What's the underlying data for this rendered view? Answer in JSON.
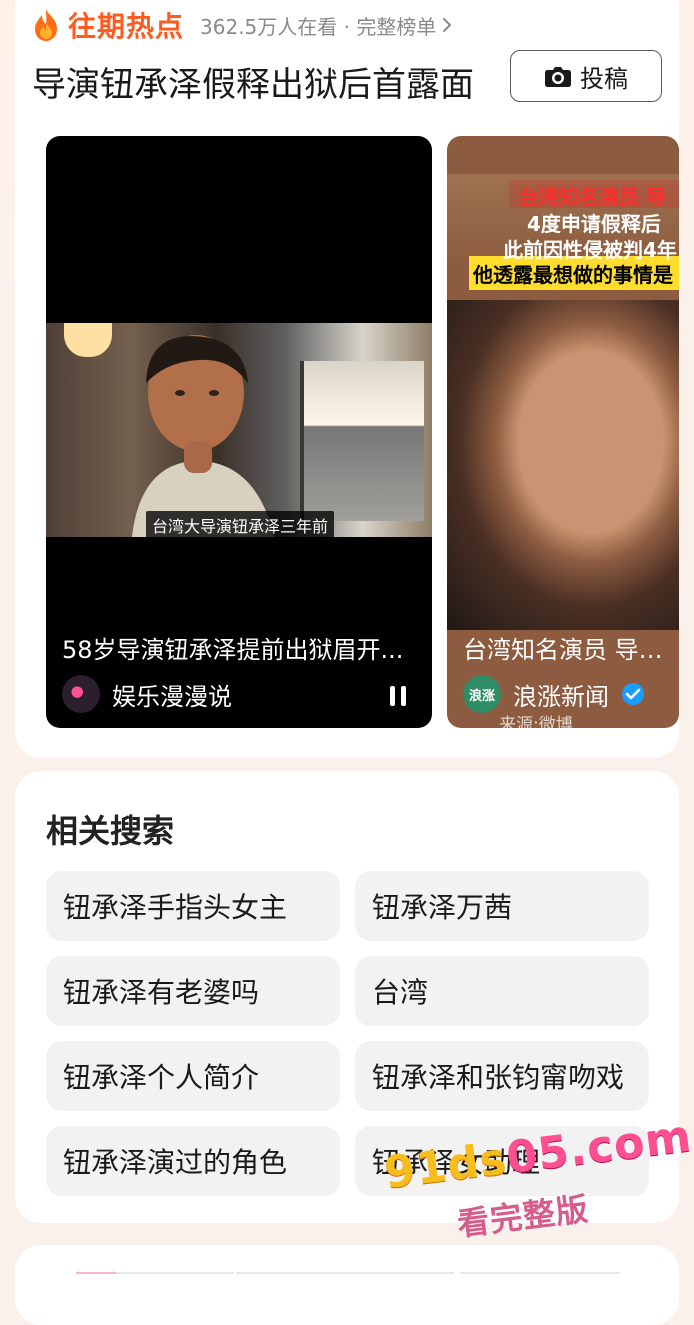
{
  "hot": {
    "title": "往期热点",
    "meta": "362.5万人在看 · 完整榜单",
    "headline": "导演钮承泽假释出狱后首露面",
    "post_label": "投稿"
  },
  "videos": [
    {
      "overlay_caption": "台湾大导演钮承泽三年前",
      "title": "58岁导演钮承泽提前出狱眉开...",
      "author": "娱乐漫漫说"
    },
    {
      "banner_lines": [
        "台湾知名演员 导",
        "4度申请假释后",
        "此前因性侵被判4年",
        "他透露最想做的事情是"
      ],
      "title": "台湾知名演员 导演钮",
      "author": "浪涨新闻",
      "avatar_text": "浪涨",
      "source_text": "来源:微博"
    }
  ],
  "related": {
    "title": "相关搜索",
    "items": [
      "钮承泽手指头女主",
      "钮承泽万茜",
      "钮承泽有老婆吗",
      "台湾",
      "钮承泽个人简介",
      "钮承泽和张钧甯吻戏",
      "钮承泽演过的角色",
      "钮承泽女助理"
    ]
  },
  "watermark": {
    "main_prefix": "91ds",
    "main_suffix": "05.com",
    "sub": "看完整版"
  },
  "colors": {
    "accent": "#ff5b1f",
    "background": "#fbf1ec",
    "chip_background": "#f2f2f2",
    "verified_blue": "#1b9cff"
  },
  "icons": {
    "flame": "flame-icon",
    "chevron": "chevron-right-icon",
    "camera": "camera-icon",
    "pause": "pause-icon",
    "verified": "verified-icon"
  }
}
